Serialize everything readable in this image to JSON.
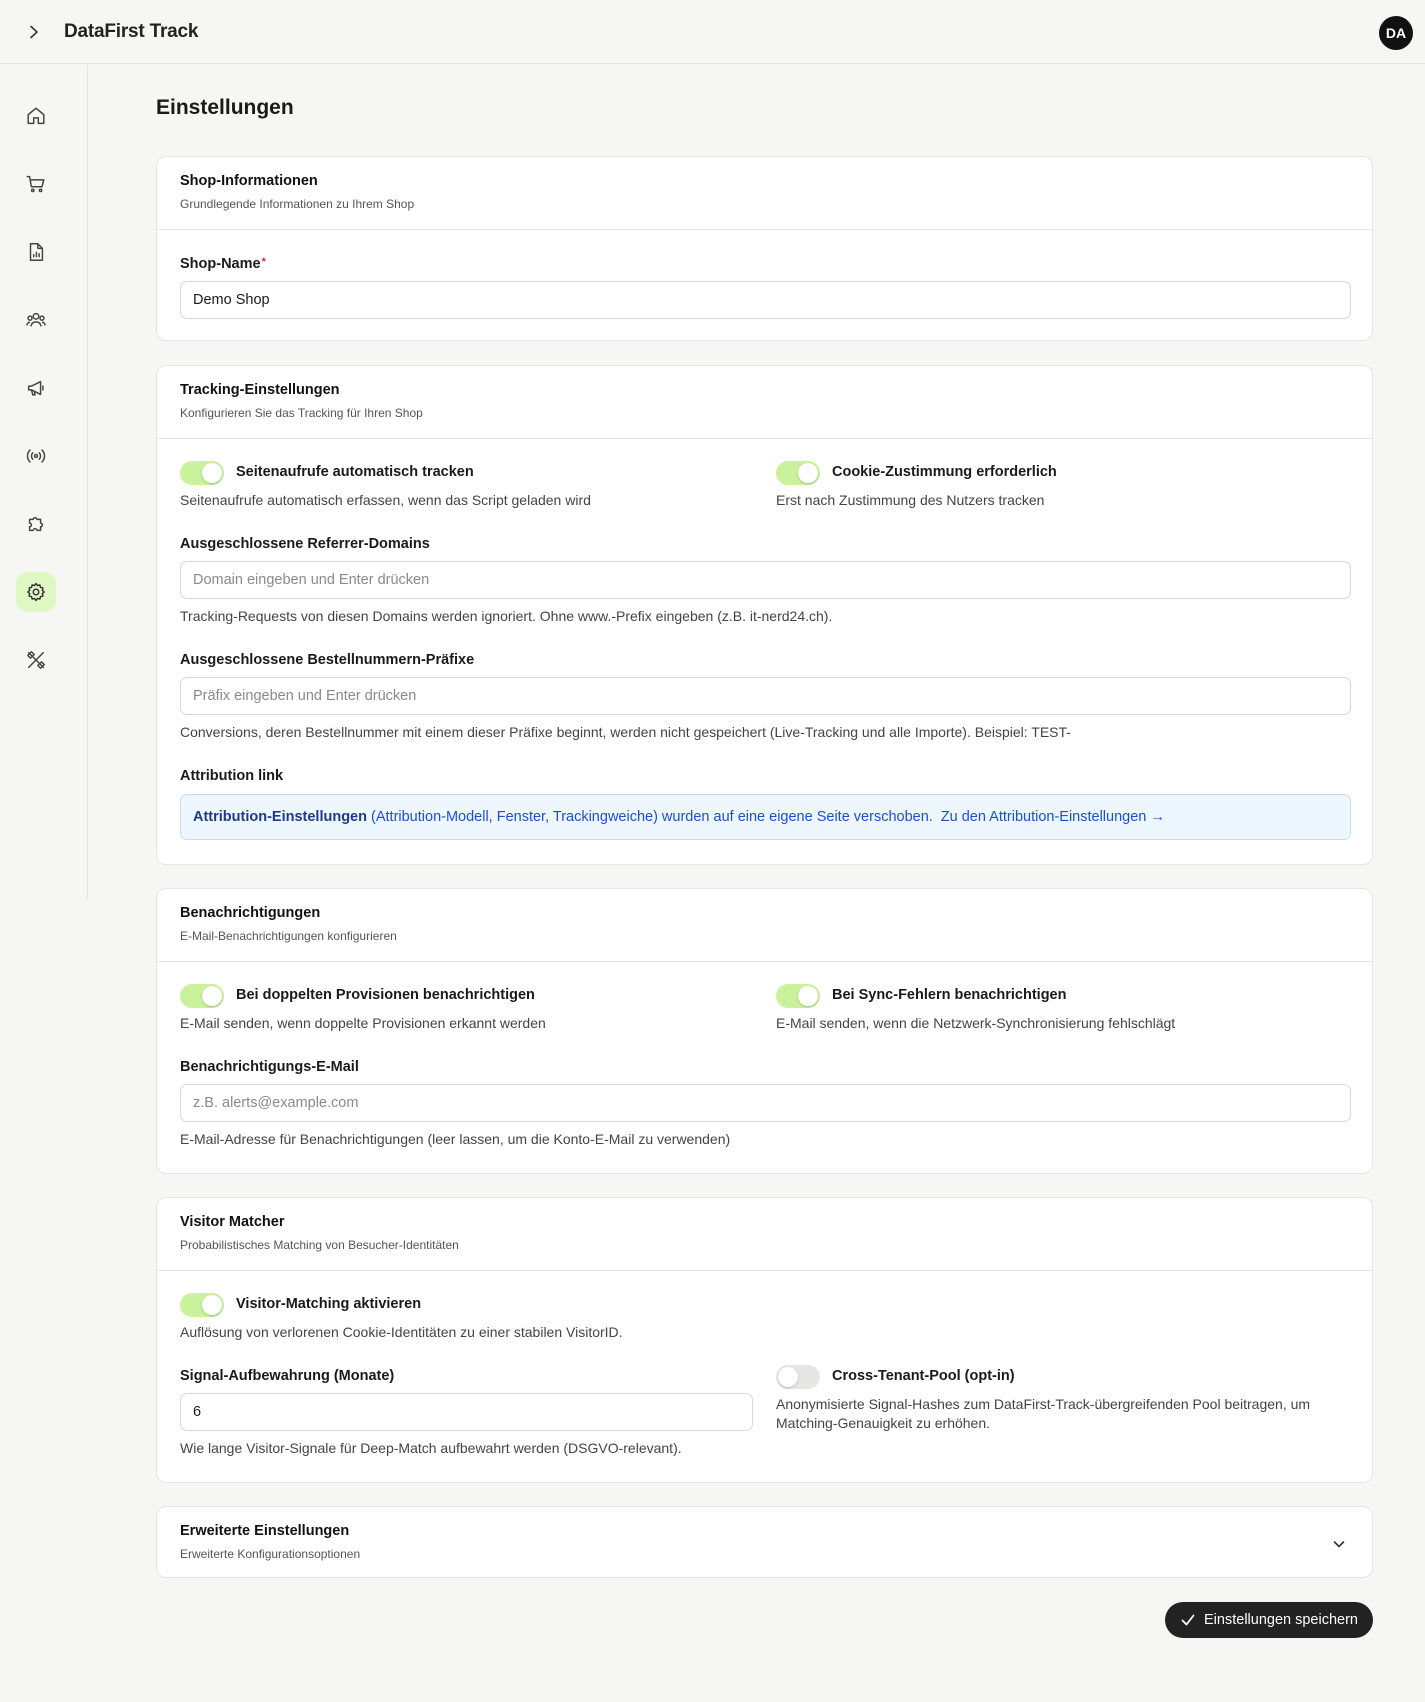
{
  "app": {
    "title": "DataFirst Track",
    "avatar_initials": "DA"
  },
  "sidebar": {
    "items": [
      {
        "icon": "home-icon"
      },
      {
        "icon": "cart-icon"
      },
      {
        "icon": "report-icon"
      },
      {
        "icon": "users-icon"
      },
      {
        "icon": "megaphone-icon"
      },
      {
        "icon": "broadcast-icon"
      },
      {
        "icon": "puzzle-icon"
      },
      {
        "icon": "gear-icon",
        "active": true
      },
      {
        "icon": "tools-icon"
      }
    ],
    "active_color": "#dff7c3"
  },
  "page": {
    "title": "Einstellungen"
  },
  "shop_info": {
    "title": "Shop-Informationen",
    "subtitle": "Grundlegende Informationen zu Ihrem Shop",
    "name_label": "Shop-Name",
    "name_required": "*",
    "name_value": "Demo Shop"
  },
  "tracking": {
    "title": "Tracking-Einstellungen",
    "subtitle": "Konfigurieren Sie das Tracking für Ihren Shop",
    "auto_track": {
      "label": "Seitenaufrufe automatisch tracken",
      "hint": "Seitenaufrufe automatisch erfassen, wenn das Script geladen wird",
      "on": true
    },
    "cookie_consent": {
      "label": "Cookie-Zustimmung erforderlich",
      "hint": "Erst nach Zustimmung des Nutzers tracken",
      "on": true
    },
    "referrer": {
      "label": "Ausgeschlossene Referrer-Domains",
      "placeholder": "Domain eingeben und Enter drücken",
      "hint": "Tracking-Requests von diesen Domains werden ignoriert. Ohne www.-Prefix eingeben (z.B. it-nerd24.ch)."
    },
    "order_prefix": {
      "label": "Ausgeschlossene Bestellnummern-Präfixe",
      "placeholder": "Präfix eingeben und Enter drücken",
      "hint": "Conversions, deren Bestellnummer mit einem dieser Präfixe beginnt, werden nicht gespeichert (Live-Tracking und alle Importe). Beispiel: TEST-"
    },
    "attribution": {
      "label": "Attribution link",
      "strong": "Attribution-Einstellungen",
      "text": " (Attribution-Modell, Fenster, Trackingweiche) wurden auf eine eigene Seite verschoben.",
      "link": "Zu den Attribution-Einstellungen →"
    }
  },
  "notifications": {
    "title": "Benachrichtigungen",
    "subtitle": "E-Mail-Benachrichtigungen konfigurieren",
    "duplicate": {
      "label": "Bei doppelten Provisionen benachrichtigen",
      "hint": "E-Mail senden, wenn doppelte Provisionen erkannt werden",
      "on": true
    },
    "sync_errors": {
      "label": "Bei Sync-Fehlern benachrichtigen",
      "hint": "E-Mail senden, wenn die Netzwerk-Synchronisierung fehlschlägt",
      "on": true
    },
    "email": {
      "label": "Benachrichtigungs-E-Mail",
      "placeholder": "z.B. alerts@example.com",
      "hint": "E-Mail-Adresse für Benachrichtigungen (leer lassen, um die Konto-E-Mail zu verwenden)"
    }
  },
  "visitor": {
    "title": "Visitor Matcher",
    "subtitle": "Probabilistisches Matching von Besucher-Identitäten",
    "matching": {
      "label": "Visitor-Matching aktivieren",
      "hint": "Auflösung von verlorenen Cookie-Identitäten zu einer stabilen VisitorID.",
      "on": true
    },
    "retention": {
      "label": "Signal-Aufbewahrung (Monate)",
      "value": "6",
      "hint": "Wie lange Visitor-Signale für Deep-Match aufbewahrt werden (DSGVO-relevant)."
    },
    "pool": {
      "label": "Cross-Tenant-Pool (opt-in)",
      "hint_line1": "Anonymisierte Signal-Hashes zum DataFirst-Track-übergreifenden Pool beitragen, um",
      "hint_line2": "Matching-Genauigkeit zu erhöhen.",
      "on": false
    }
  },
  "advanced": {
    "title": "Erweiterte Einstellungen",
    "subtitle": "Erweiterte Konfigurationsoptionen"
  },
  "actions": {
    "save_label": "Einstellungen speichern"
  }
}
